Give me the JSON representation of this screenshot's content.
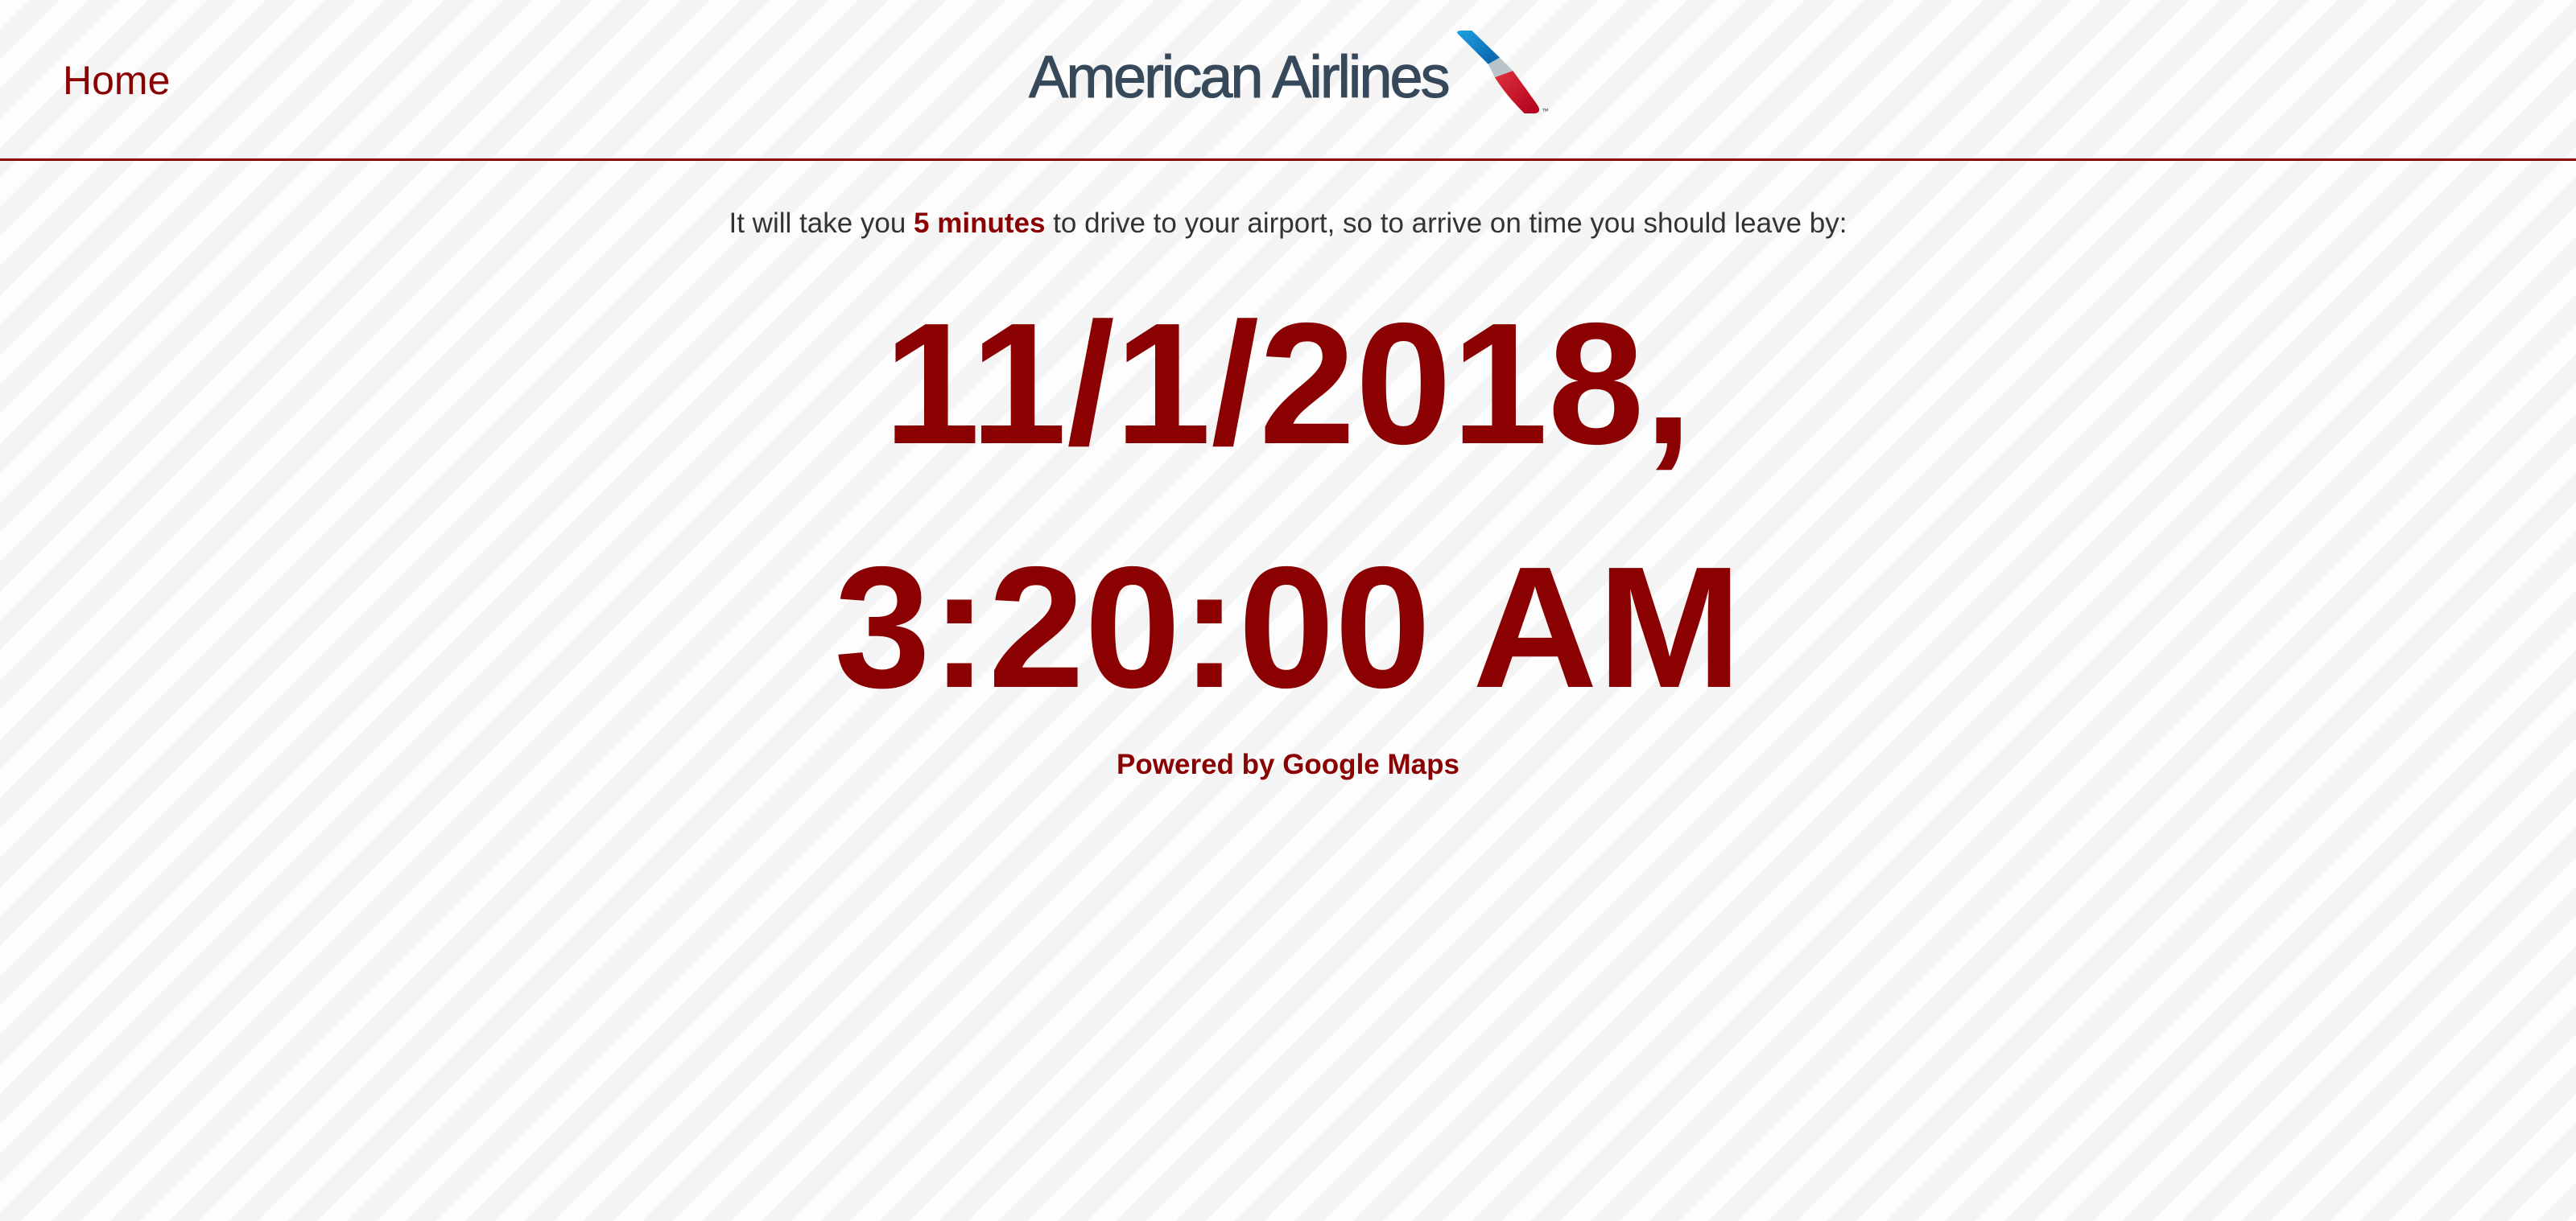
{
  "header": {
    "home_label": "Home",
    "logo_text": "American Airlines",
    "logo_trademark": "™"
  },
  "message": {
    "prefix": "It will take you",
    "drive_time": "5 minutes",
    "suffix": "to drive to your airport, so to arrive on time you should leave by:"
  },
  "leave_by": {
    "date_line": "11/1/2018,",
    "time_line": "3:20:00 AM"
  },
  "attribution": "Powered by Google Maps",
  "icons": {
    "logo_symbol": "american-airlines-flight-symbol-icon"
  },
  "colors": {
    "accent": "#8b0000",
    "text": "#333333",
    "logo_text": "#36495a",
    "logo_blue": "#0b5ea8",
    "logo_blue_light": "#1ba3e0",
    "logo_red": "#e0313e",
    "logo_red_dark": "#b0001c",
    "logo_silver": "#b9c3ca",
    "background": "#fdfdfd",
    "background_stripe": "#f4f4f4"
  }
}
